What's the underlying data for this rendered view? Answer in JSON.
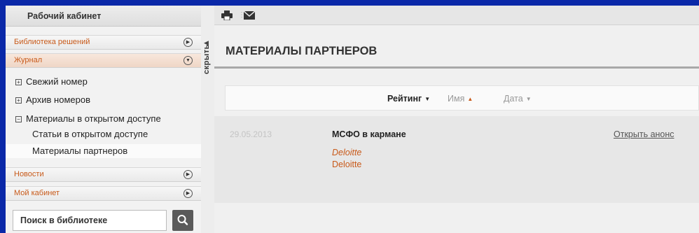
{
  "sidebar": {
    "title": "Рабочий кабинет",
    "sections": {
      "library": "Библиотека решений",
      "journal": "Журнал",
      "news": "Новости",
      "cabinet": "Мой кабинет"
    },
    "journal_items": {
      "fresh_issue": "Свежий номер",
      "archive": "Архив номеров",
      "open_materials": "Материалы в открытом доступе"
    },
    "open_sub_items": {
      "articles": "Статьи в открытом доступе",
      "partners": "Материалы партнеров"
    },
    "search": {
      "placeholder": "Поиск в библиотеке"
    },
    "collapse_label": "скрыть"
  },
  "main": {
    "title": "МАТЕРИАЛЫ ПАРТНЕРОВ",
    "sort": {
      "rating": "Рейтинг",
      "name": "Имя",
      "date": "Дата"
    },
    "results": [
      {
        "date": "29.05.2013",
        "title": "МСФО в кармане",
        "author": "Deloitte",
        "company": "Deloitte",
        "action": "Открыть анонс"
      }
    ]
  },
  "colors": {
    "background": "#0a28a8",
    "accent": "#c85a1a",
    "panel": "#f0f0f0"
  },
  "icons": [
    "print-icon",
    "mail-icon",
    "search-icon",
    "expand-circle-icon",
    "collapse-circle-icon",
    "plus-box-icon",
    "minus-box-icon",
    "collapse-arrow-icon"
  ]
}
